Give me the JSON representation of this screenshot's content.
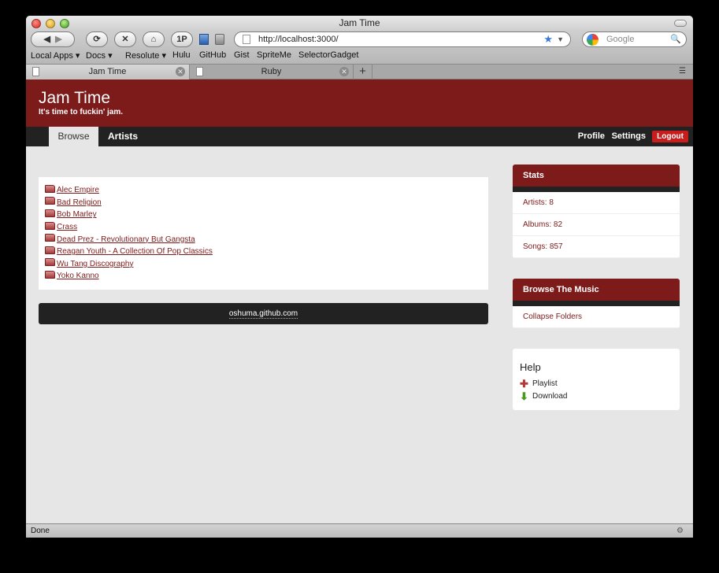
{
  "window": {
    "title": "Jam Time"
  },
  "toolbar": {
    "back_icon": "back-arrow-icon",
    "forward_icon": "forward-arrow-icon",
    "reload_glyph": "⟳",
    "stop_glyph": "✕",
    "home_glyph": "⌂",
    "onepassword_label": "1P",
    "url": "http://localhost:3000/",
    "search_placeholder": "Google"
  },
  "bookmarks": [
    "Local Apps ▾",
    "Docs ▾",
    "Resolute ▾",
    "Hulu",
    "GitHub",
    "Gist",
    "SpriteMe",
    "SelectorGadget"
  ],
  "tabs": [
    {
      "label": "Jam Time",
      "active": true
    },
    {
      "label": "Ruby",
      "active": false
    }
  ],
  "page": {
    "site_title": "Jam Time",
    "tagline": "It's time to fuckin' jam.",
    "nav": {
      "browse": "Browse",
      "artists": "Artists",
      "profile": "Profile",
      "settings": "Settings",
      "logout": "Logout"
    },
    "folders": [
      "Alec Empire",
      "Bad Religion",
      "Bob Marley",
      "Crass",
      "Dead Prez - Revolutionary But Gangsta",
      "Reagan Youth - A Collection Of Pop Classics",
      "Wu Tang Discography",
      "Yoko Kanno"
    ],
    "footer": "oshuma.github.com",
    "stats": {
      "title": "Stats",
      "artists": "Artists: 8",
      "albums": "Albums: 82",
      "songs": "Songs: 857"
    },
    "browse_music": {
      "title": "Browse The Music",
      "collapse": "Collapse Folders"
    },
    "help": {
      "title": "Help",
      "playlist": "Playlist",
      "download": "Download"
    }
  },
  "status": {
    "text": "Done"
  },
  "colors": {
    "brand": "#7d1a1a",
    "nav": "#222222",
    "logout": "#c81d1d"
  }
}
